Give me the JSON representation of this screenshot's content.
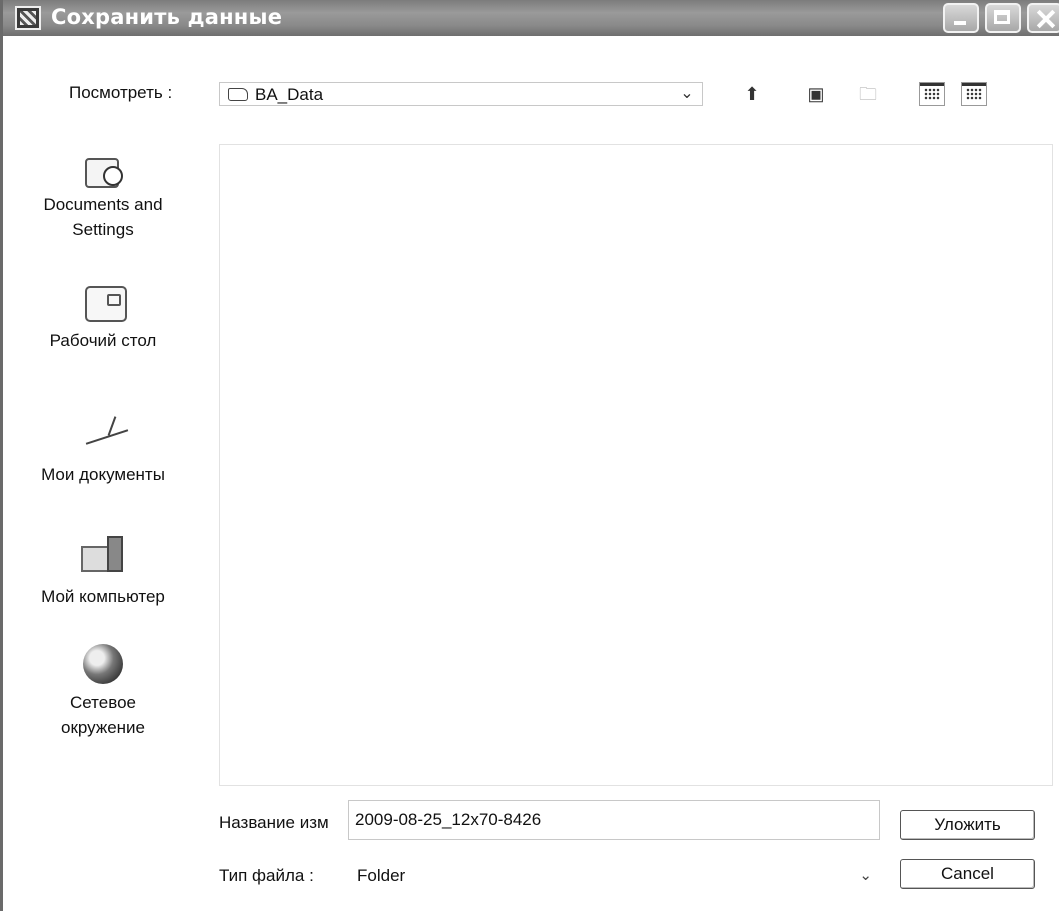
{
  "window": {
    "title": "Сохранить данные"
  },
  "toolbar": {
    "look_in_label": "Посмотреть :",
    "look_in_value": "BA_Data",
    "icons": [
      "folder-icon",
      "up-folder-icon",
      "desktop-icon",
      "new-folder-icon",
      "list-view-icon",
      "details-view-icon"
    ]
  },
  "places": [
    {
      "label": "Documents and\nSettings",
      "icon": "documents-settings-icon"
    },
    {
      "label": "Рабочий стол",
      "icon": "desktop-icon"
    },
    {
      "label": "Мои документы",
      "icon": "my-documents-icon"
    },
    {
      "label": "Мой компьютер",
      "icon": "my-computer-icon"
    },
    {
      "label": "Сетевое\nокружение",
      "icon": "network-icon"
    }
  ],
  "form": {
    "filename_label": "Название изм",
    "filename_value": "2009-08-25_12x70-8426",
    "filetype_label": "Тип файла :",
    "filetype_value": "Folder",
    "save_label": "Уложить",
    "cancel_label": "Cancel"
  },
  "colors": {
    "title_bar": "#8a8a8a",
    "title_text": "#ffffff",
    "background": "#ffffff"
  }
}
